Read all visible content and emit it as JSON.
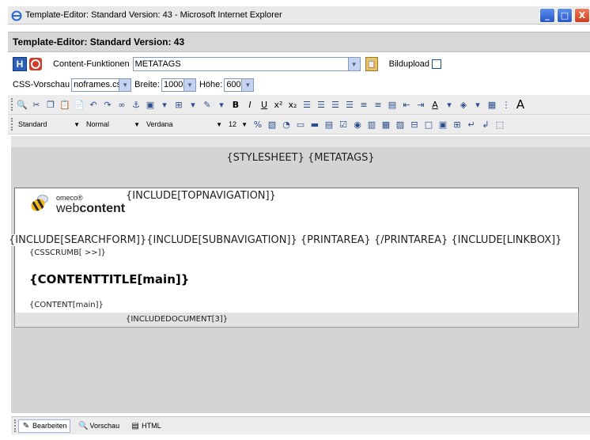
{
  "window": {
    "title": "Template-Editor: Standard Version: 43 - Microsoft Internet Explorer",
    "minimize": "_",
    "maximize": "□",
    "close": "X"
  },
  "editor_header": {
    "title": "Template-Editor: Standard Version: 43"
  },
  "content_row": {
    "save_glyph": "H",
    "content_label": "Content-Funktionen",
    "content_value": "METATAGS",
    "bildupload_label": "Bildupload"
  },
  "css_row": {
    "preview_label": "CSS-Vorschau",
    "css_value": "noframes.css",
    "width_label": "Breite:",
    "width_value": "1000",
    "height_label": "Höhe:",
    "height_value": "600"
  },
  "toolbar2": {
    "style_value": "Standard",
    "format_value": "Normal",
    "font_value": "Verdana",
    "size_value": "12"
  },
  "editor": {
    "stylesheet_line": "{STYLESHEET} {METATAGS}",
    "logo_small": "omeco®",
    "logo_web": "web",
    "logo_content": "content",
    "topnav": "{INCLUDE[TOPNAVIGATION]}",
    "search_line": "{INCLUDE[SEARCHFORM]}{INCLUDE[SUBNAVIGATION]} {PRINTAREA} {/PRINTAREA} {INCLUDE[LINKBOX]}",
    "crumb": "{CSSCRUMB[ >>]}",
    "content_title": "{CONTENTTITLE[main]}",
    "content_main": "{CONTENT[main]}",
    "include_document": "{INCLUDEDOCUMENT[3]}"
  },
  "tabs": [
    {
      "label": "Bearbeiten"
    },
    {
      "label": "Vorschau"
    },
    {
      "label": "HTML"
    }
  ],
  "colors": {
    "accent": "#2b5fb8",
    "close": "#d43b2a",
    "editor_bg": "#d4d4d4"
  }
}
